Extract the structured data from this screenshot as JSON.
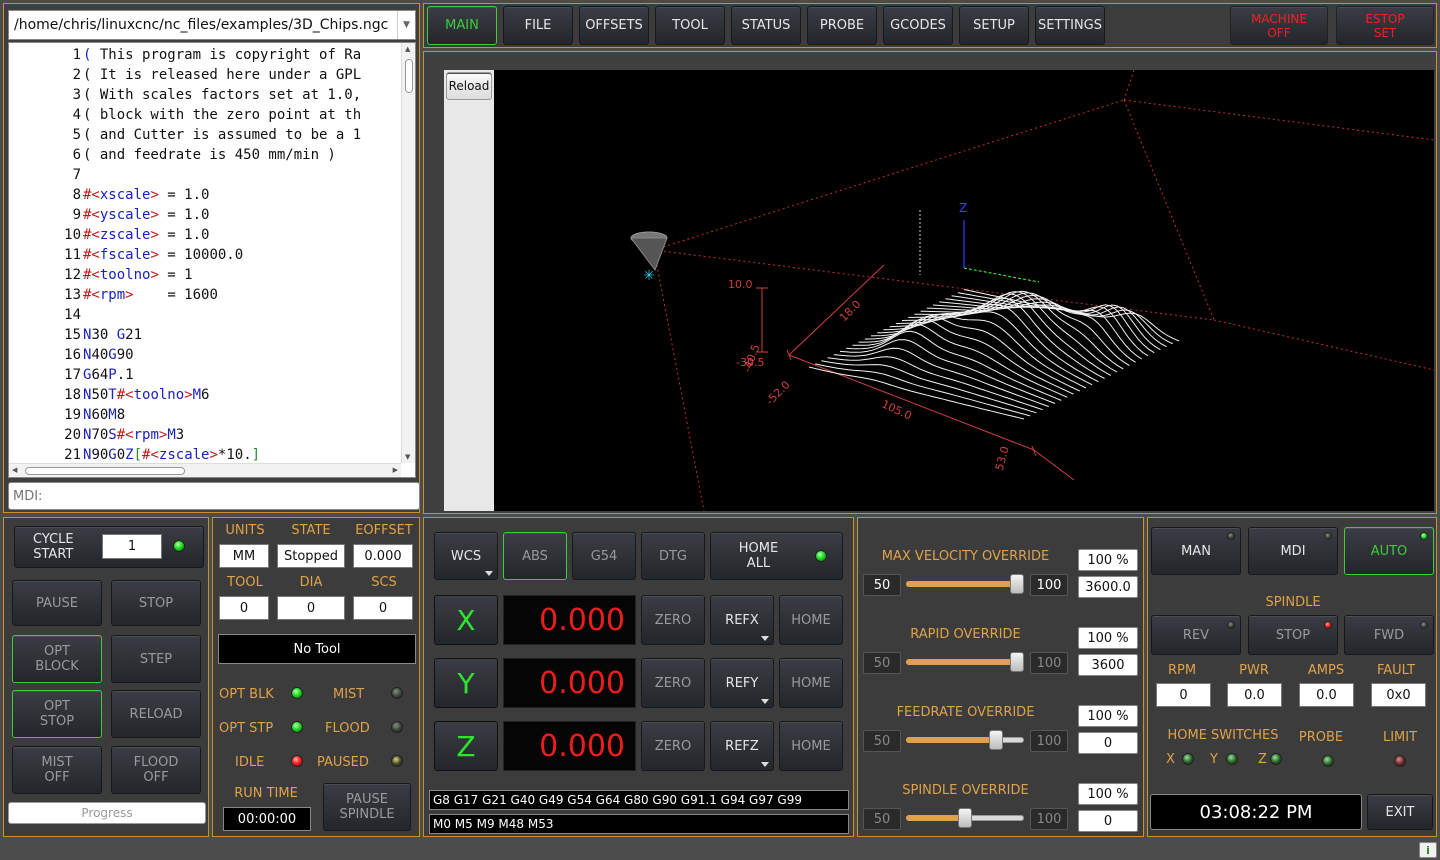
{
  "file": {
    "path": "/home/chris/linuxcnc/nc_files/examples/3D_Chips.ngc"
  },
  "gcode": {
    "lines": [
      {
        "n": "1",
        "parts": [
          [
            "(",
            "k"
          ],
          [
            " This program is copyright of Ra",
            ""
          ]
        ]
      },
      {
        "n": "2",
        "parts": [
          [
            "( It is released here under a GPL",
            ""
          ]
        ]
      },
      {
        "n": "3",
        "parts": [
          [
            "( With scales factors set at 1.0,",
            ""
          ]
        ]
      },
      {
        "n": "4",
        "parts": [
          [
            "( block with the zero point at th",
            ""
          ]
        ]
      },
      {
        "n": "5",
        "parts": [
          [
            "( and Cutter is assumed to be a 1",
            ""
          ]
        ]
      },
      {
        "n": "6",
        "parts": [
          [
            "( and feedrate is 450 mm/min )",
            ""
          ]
        ]
      },
      {
        "n": "7",
        "parts": []
      },
      {
        "n": "8",
        "parts": [
          [
            "#<",
            "r"
          ],
          [
            "xscale",
            "k"
          ],
          [
            "> ",
            "r"
          ],
          [
            "= 1.0",
            ""
          ]
        ]
      },
      {
        "n": "9",
        "parts": [
          [
            "#<",
            "r"
          ],
          [
            "yscale",
            "k"
          ],
          [
            "> ",
            "r"
          ],
          [
            "= 1.0",
            ""
          ]
        ]
      },
      {
        "n": "10",
        "parts": [
          [
            "#<",
            "r"
          ],
          [
            "zscale",
            "k"
          ],
          [
            "> ",
            "r"
          ],
          [
            "= 1.0",
            ""
          ]
        ]
      },
      {
        "n": "11",
        "parts": [
          [
            "#<",
            "r"
          ],
          [
            "fscale",
            "k"
          ],
          [
            "> ",
            "r"
          ],
          [
            "= 10000.0",
            ""
          ]
        ]
      },
      {
        "n": "12",
        "parts": [
          [
            "#<",
            "r"
          ],
          [
            "toolno",
            "k"
          ],
          [
            "> ",
            "r"
          ],
          [
            "= 1",
            ""
          ]
        ]
      },
      {
        "n": "13",
        "parts": [
          [
            "#<",
            "r"
          ],
          [
            "rpm",
            "k"
          ],
          [
            ">    ",
            "r"
          ],
          [
            "= 1600",
            ""
          ]
        ]
      },
      {
        "n": "14",
        "parts": []
      },
      {
        "n": "15",
        "parts": [
          [
            "N",
            "k"
          ],
          [
            "30 ",
            ""
          ],
          [
            "G",
            "k"
          ],
          [
            "21",
            ""
          ]
        ]
      },
      {
        "n": "16",
        "parts": [
          [
            "N",
            "k"
          ],
          [
            "40",
            ""
          ],
          [
            "G",
            "k"
          ],
          [
            "90",
            ""
          ]
        ]
      },
      {
        "n": "17",
        "parts": [
          [
            "G",
            "k"
          ],
          [
            "64",
            ""
          ],
          [
            "P",
            "k"
          ],
          [
            ".1",
            ""
          ]
        ]
      },
      {
        "n": "18",
        "parts": [
          [
            "N",
            "k"
          ],
          [
            "50",
            ""
          ],
          [
            "T",
            "k"
          ],
          [
            "#<",
            "r"
          ],
          [
            "toolno",
            "k"
          ],
          [
            ">",
            "r"
          ],
          [
            "M",
            "k"
          ],
          [
            "6",
            ""
          ]
        ]
      },
      {
        "n": "19",
        "parts": [
          [
            "N",
            "k"
          ],
          [
            "60",
            ""
          ],
          [
            "M",
            "k"
          ],
          [
            "8",
            ""
          ]
        ]
      },
      {
        "n": "20",
        "parts": [
          [
            "N",
            "k"
          ],
          [
            "70",
            ""
          ],
          [
            "S",
            "k"
          ],
          [
            "#<",
            "r"
          ],
          [
            "rpm",
            "k"
          ],
          [
            ">",
            "r"
          ],
          [
            "M",
            "k"
          ],
          [
            "3",
            ""
          ]
        ]
      },
      {
        "n": "21",
        "parts": [
          [
            "N",
            "k"
          ],
          [
            "90",
            ""
          ],
          [
            "G",
            "k"
          ],
          [
            "0",
            ""
          ],
          [
            "Z",
            "k"
          ],
          [
            "[",
            "g"
          ],
          [
            "#<",
            "r"
          ],
          [
            "zscale",
            "k"
          ],
          [
            ">",
            "r"
          ],
          [
            "*10.",
            ""
          ],
          [
            "]",
            "g"
          ]
        ]
      }
    ]
  },
  "mdi": {
    "placeholder": "MDI:"
  },
  "tabs": [
    {
      "id": "main",
      "label": "MAIN",
      "active": true
    },
    {
      "id": "file",
      "label": "FILE"
    },
    {
      "id": "offsets",
      "label": "OFFSETS"
    },
    {
      "id": "tool",
      "label": "TOOL"
    },
    {
      "id": "status",
      "label": "STATUS"
    },
    {
      "id": "probe",
      "label": "PROBE"
    },
    {
      "id": "gcodes",
      "label": "GCODES"
    },
    {
      "id": "setup",
      "label": "SETUP"
    },
    {
      "id": "settings",
      "label": "SETTINGS"
    }
  ],
  "machine_buttons": {
    "machine_off": "MACHINE\nOFF",
    "estop": "ESTOP\nSET"
  },
  "view": {
    "reload": "Reload",
    "labels": {
      "z": "Z",
      "v1": "10.0",
      "v2": "-30.5",
      "v3": "-52.0",
      "v4": "105.0",
      "v5": "53.0",
      "v6": "-40.5",
      "v7": "18.0"
    }
  },
  "cycle": {
    "cycle_start": "CYCLE\nSTART",
    "count": "1",
    "pause": "PAUSE",
    "stop": "STOP",
    "opt_block": "OPT\nBLOCK",
    "step": "STEP",
    "opt_stop": "OPT\nSTOP",
    "reload": "RELOAD",
    "mist_off": "MIST\nOFF",
    "flood_off": "FLOOD\nOFF",
    "progress": "Progress"
  },
  "info": {
    "units_label": "UNITS",
    "state_label": "STATE",
    "eoffset_label": "EOFFSET",
    "units": "MM",
    "state": "Stopped",
    "eoffset": "0.000",
    "tool_label": "TOOL",
    "dia_label": "DIA",
    "scs_label": "SCS",
    "tool": "0",
    "dia": "0",
    "scs": "0",
    "no_tool": "No Tool",
    "opt_blk": "OPT BLK",
    "mist": "MIST",
    "opt_stp": "OPT STP",
    "flood": "FLOOD",
    "idle": "IDLE",
    "paused": "PAUSED",
    "run_time_label": "RUN TIME",
    "run_time": "00:00:00",
    "pause_spindle": "PAUSE\nSPINDLE"
  },
  "dro": {
    "wcs": "WCS",
    "abs": "ABS",
    "g54": "G54",
    "dtg": "DTG",
    "home_all": "HOME\nALL",
    "axes": [
      {
        "name": "X",
        "value": "0.000",
        "ref": "REFX"
      },
      {
        "name": "Y",
        "value": "0.000",
        "ref": "REFY"
      },
      {
        "name": "Z",
        "value": "0.000",
        "ref": "REFZ"
      }
    ],
    "zero": "ZERO",
    "home": "HOME",
    "gcodes": "G8 G17 G21 G40 G49 G54 G64 G80 G90 G91.1 G94 G97 G99",
    "mcodes": "M0 M5 M9 M48 M53"
  },
  "overrides": [
    {
      "label": "MAX VELOCITY OVERRIDE",
      "min": "50",
      "max": "100",
      "percent": "100 %",
      "value": "3600.0",
      "pos": 1.0
    },
    {
      "label": "RAPID OVERRIDE",
      "min": "50",
      "max": "100",
      "percent": "100 %",
      "value": "3600",
      "pos": 1.0
    },
    {
      "label": "FEEDRATE OVERRIDE",
      "min": "50",
      "max": "100",
      "percent": "100 %",
      "value": "0",
      "pos": 0.8
    },
    {
      "label": "SPINDLE OVERRIDE",
      "min": "50",
      "max": "100",
      "percent": "100 %",
      "value": "0",
      "pos": 0.5
    }
  ],
  "mode": {
    "man": "MAN",
    "mdi": "MDI",
    "auto": "AUTO"
  },
  "spindle": {
    "title": "SPINDLE",
    "rev": "REV",
    "stop": "STOP",
    "fwd": "FWD",
    "rpm_label": "RPM",
    "pwr_label": "PWR",
    "amps_label": "AMPS",
    "fault_label": "FAULT",
    "rpm": "0",
    "pwr": "0.0",
    "amps": "0.0",
    "fault": "0x0",
    "home_switches": "HOME SWITCHES",
    "probe": "PROBE",
    "limit": "LIMIT",
    "x": "X",
    "y": "Y",
    "z": "Z"
  },
  "clock": "03:08:22 PM",
  "exit": "EXIT",
  "colors": {
    "accent": "#c8902e",
    "led_green": "#1ddc1d",
    "led_red": "#ff2020",
    "dro_red": "#ee1c1c"
  }
}
